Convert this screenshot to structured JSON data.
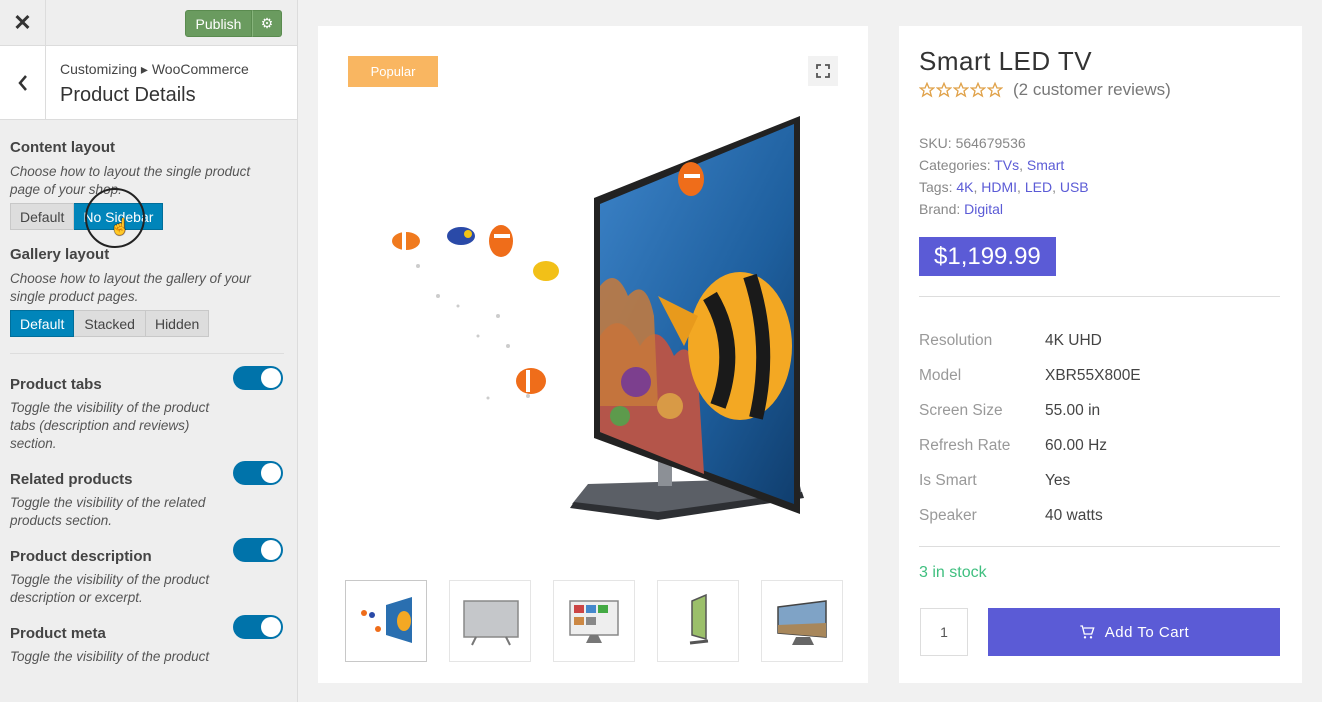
{
  "topbar": {
    "close_label": "✕",
    "publish_label": "Publish",
    "settings_glyph": "⚙"
  },
  "section": {
    "breadcrumb": "Customizing ▸ WooCommerce",
    "title": "Product Details"
  },
  "controls": {
    "content_layout": {
      "title": "Content layout",
      "desc": "Choose how to layout the single product page of your shop.",
      "options": [
        "Default",
        "No Sidebar"
      ],
      "selected": "No Sidebar"
    },
    "gallery_layout": {
      "title": "Gallery layout",
      "desc": "Choose how to layout the gallery of your single product pages.",
      "options": [
        "Default",
        "Stacked",
        "Hidden"
      ],
      "selected": "Default"
    },
    "toggles": [
      {
        "title": "Product tabs",
        "desc": "Toggle the visibility of the product tabs (description and reviews) section.",
        "on": true
      },
      {
        "title": "Related products",
        "desc": "Toggle the visibility of the related products section.",
        "on": true
      },
      {
        "title": "Product description",
        "desc": "Toggle the visibility of the product description or excerpt.",
        "on": true
      },
      {
        "title": "Product meta",
        "desc": "Toggle the visibility of the product",
        "on": true
      }
    ]
  },
  "product": {
    "badge": "Popular",
    "title": "Smart LED TV",
    "rating": 0,
    "reviews": "(2 customer reviews)",
    "sku_label": "SKU:",
    "sku": "564679536",
    "categories_label": "Categories:",
    "categories": [
      "TVs",
      "Smart"
    ],
    "tags_label": "Tags:",
    "tags": [
      "4K",
      "HDMI",
      "LED",
      "USB"
    ],
    "brand_label": "Brand:",
    "brand": "Digital",
    "price": "$1,199.99",
    "specs": [
      {
        "k": "Resolution",
        "v": "4K UHD"
      },
      {
        "k": "Model",
        "v": "XBR55X800E"
      },
      {
        "k": "Screen Size",
        "v": "55.00 in"
      },
      {
        "k": "Refresh Rate",
        "v": "60.00 Hz"
      },
      {
        "k": "Is Smart",
        "v": "Yes"
      },
      {
        "k": "Speaker",
        "v": "40 watts"
      }
    ],
    "stock": "3 in stock",
    "quantity": "1",
    "add_to_cart": "Add To Cart"
  },
  "colors": {
    "accent": "#5b5bd6",
    "wp_blue": "#0085ba",
    "publish_green": "#6a9b5f",
    "badge": "#f9b661",
    "stock": "#3fbf7f"
  }
}
